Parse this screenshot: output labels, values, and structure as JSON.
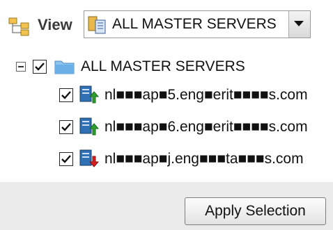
{
  "toolbar": {
    "view_icon": "hierarchy-icon",
    "view_label": "View",
    "select": {
      "icon": "server-list-icon",
      "value": "ALL MASTER SERVERS",
      "dropdown_icon": "chevron-down-icon"
    }
  },
  "tree": {
    "root": {
      "expander_icon": "collapse-minus-icon",
      "checked": true,
      "icon": "folder-icon",
      "label": "ALL MASTER SERVERS"
    },
    "children": [
      {
        "checked": true,
        "icon": "server-up-icon",
        "status": "up",
        "label": "nl■■■ap■5.eng■erit■■■■s.com"
      },
      {
        "checked": true,
        "icon": "server-up-icon",
        "status": "up",
        "label": "nl■■■ap■6.eng■erit■■■■s.com"
      },
      {
        "checked": true,
        "icon": "server-down-icon",
        "status": "down",
        "label": "nl■■■ap■j.eng■■■ta■■■s.com"
      }
    ]
  },
  "footer": {
    "apply_button_label": "Apply Selection"
  },
  "colors": {
    "footer_bg": "#ebebeb",
    "folder": "#6ab0e6",
    "server_body": "#2f6fb3",
    "status_up": "#2e9e2e",
    "status_down": "#d42020"
  }
}
